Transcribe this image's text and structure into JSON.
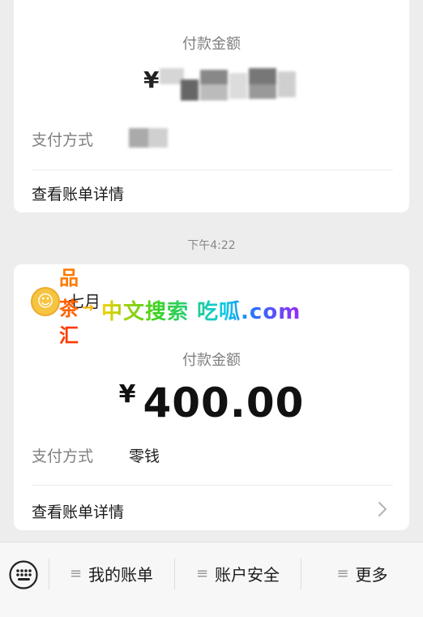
{
  "card1": {
    "amount_label": "付款金额",
    "amount_prefix": "¥",
    "payment_method_label": "支付方式",
    "detail_link": "查看账单详情"
  },
  "timestamp": "下午4:22",
  "card2": {
    "amount_label": "付款金额",
    "amount_prefix": "¥",
    "amount_value": "400.00",
    "payment_method_label": "支付方式",
    "payment_method_value": "零钱",
    "detail_link": "查看账单详情"
  },
  "watermark": {
    "vertical_chars": [
      "品",
      "茶",
      "汇"
    ],
    "partial_text": "七月",
    "arrow": "→",
    "text": "中文搜索  吃呱.com"
  },
  "bottom_bar": {
    "menu": [
      {
        "label": "我的账单"
      },
      {
        "label": "账户安全"
      },
      {
        "label": "更多"
      }
    ]
  },
  "icons": {
    "keyboard": "keyboard-icon",
    "menu": "hamburger-icon",
    "chevron": "chevron-right-icon"
  }
}
